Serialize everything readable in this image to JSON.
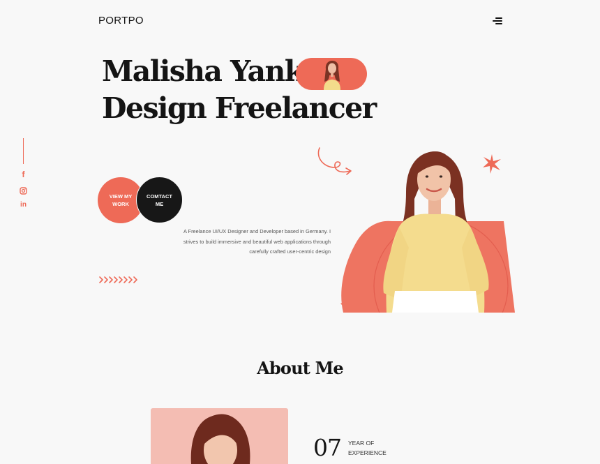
{
  "header": {
    "logo": "PORTPO",
    "menu_icon": "hamburger-menu-icon"
  },
  "hero": {
    "title_line1": "Malisha Yank",
    "title_line2": "Design Freelancer",
    "view_work_label": "VIEW MY WORK",
    "contact_label": "COMTACT ME",
    "description": "A Freelance UI/UX Designer and Developer based in Germany. I strives to build immersive and beautiful web applications through carefully crafted user-centric design"
  },
  "social": {
    "icons": [
      "facebook-icon",
      "instagram-icon",
      "linkedin-icon"
    ],
    "facebook_glyph": "f",
    "linkedin_glyph": "in"
  },
  "about": {
    "title": "About Me",
    "stat_number": "07",
    "stat_label": "YEAR OF EXPERIENCE"
  },
  "colors": {
    "accent": "#ee6a57",
    "dark": "#171717",
    "background": "#f8f8f8",
    "photo_bg": "#f4bdb3"
  }
}
